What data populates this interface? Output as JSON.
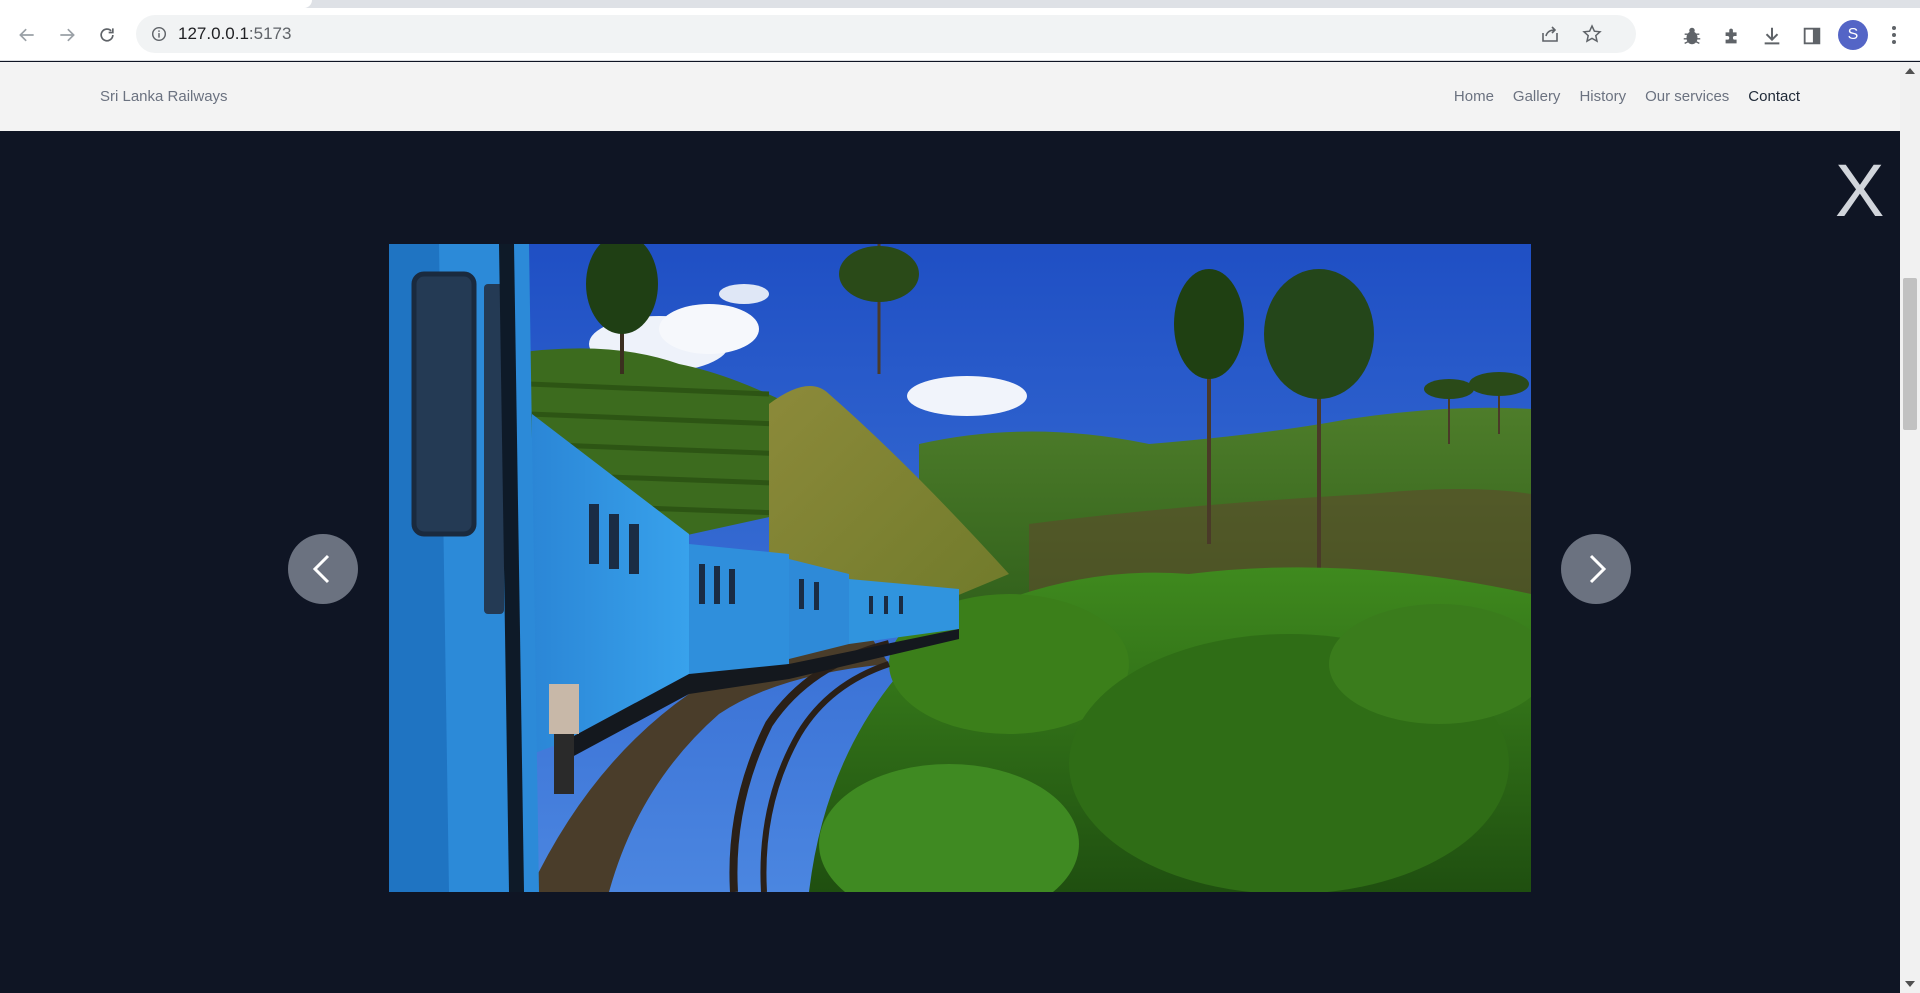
{
  "browser": {
    "url_host": "127.0.0.1",
    "url_port": ":5173",
    "profile_initial": "S",
    "icons": [
      "back-icon",
      "forward-icon",
      "reload-icon",
      "info-icon",
      "share-icon",
      "star-icon",
      "bug-icon",
      "extensions-icon",
      "download-icon",
      "side-panel-icon",
      "menu-icon"
    ]
  },
  "header": {
    "brand": "Sri Lanka Railways",
    "nav": [
      {
        "label": "Home"
      },
      {
        "label": "Gallery"
      },
      {
        "label": "History"
      },
      {
        "label": "Our services"
      },
      {
        "label": "Contact"
      }
    ]
  },
  "lightbox": {
    "close_label": "X",
    "prev_icon": "chevron-left-icon",
    "next_icon": "chevron-right-icon"
  },
  "colors": {
    "page_bg": "#0f1524",
    "header_bg": "#f3f3f3",
    "nav_text": "#6b7280",
    "nav_active": "#1f2937",
    "arrow_bg": "#6b7280"
  }
}
